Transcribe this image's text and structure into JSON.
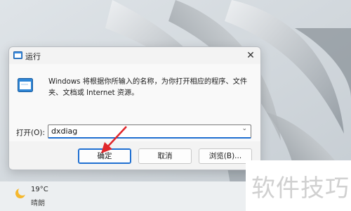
{
  "dialog": {
    "title": "运行",
    "close_symbol": "✕",
    "description": "Windows 将根据你所输入的名称，为你打开相应的程序、文件夹、文档或 Internet 资源。",
    "open_label": "打开(O):",
    "open_value": "dxdiag",
    "dropdown_symbol": "⌄",
    "buttons": {
      "ok": "确定",
      "cancel": "取消",
      "browse": "浏览(B)..."
    }
  },
  "taskbar": {
    "temperature": "19°C",
    "weather": "晴朗",
    "weather_icon": "crescent-moon-icon"
  },
  "watermark": {
    "text": "软件技巧"
  },
  "colors": {
    "accent": "#1f6fd1",
    "arrow": "#e0262b"
  }
}
